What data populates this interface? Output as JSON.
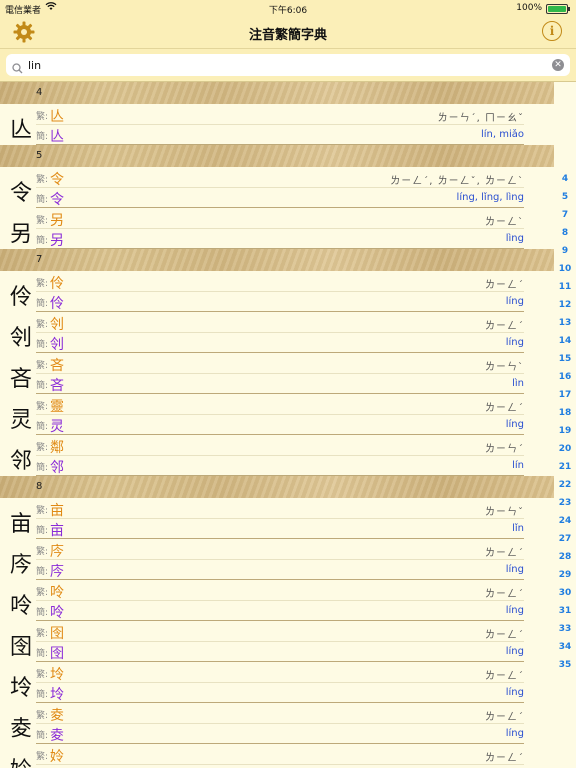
{
  "status": {
    "carrier": "電信業者",
    "time": "下午6:06",
    "battery": "100%"
  },
  "nav": {
    "title": "注音繁簡字典"
  },
  "search": {
    "value": "lin",
    "placeholder": ""
  },
  "sections": [
    {
      "label": "4",
      "entries": [
        {
          "char": "亾",
          "trad": "亾",
          "simp": "亾",
          "zhuyin": "ㄌㄧㄣˊ, ㄇㄧㄠˇ",
          "pinyin": "lín, miǎo"
        }
      ]
    },
    {
      "label": "5",
      "entries": [
        {
          "char": "令",
          "trad": "令",
          "simp": "令",
          "zhuyin": "ㄌㄧㄥˊ, ㄌㄧㄥˇ, ㄌㄧㄥˋ",
          "pinyin": "líng, lǐng, lìng"
        },
        {
          "char": "另",
          "trad": "另",
          "simp": "另",
          "zhuyin": "ㄌㄧㄥˋ",
          "pinyin": "lìng"
        }
      ]
    },
    {
      "label": "7",
      "entries": [
        {
          "char": "伶",
          "trad": "伶",
          "simp": "伶",
          "zhuyin": "ㄌㄧㄥˊ",
          "pinyin": "líng"
        },
        {
          "char": "刢",
          "trad": "刢",
          "simp": "刢",
          "zhuyin": "ㄌㄧㄥˊ",
          "pinyin": "líng"
        },
        {
          "char": "吝",
          "trad": "吝",
          "simp": "吝",
          "zhuyin": "ㄌㄧㄣˋ",
          "pinyin": "lìn"
        },
        {
          "char": "灵",
          "trad": "靈",
          "simp": "灵",
          "zhuyin": "ㄌㄧㄥˊ",
          "pinyin": "líng"
        },
        {
          "char": "邻",
          "trad": "鄰",
          "simp": "邻",
          "zhuyin": "ㄌㄧㄣˊ",
          "pinyin": "lín"
        }
      ]
    },
    {
      "label": "8",
      "entries": [
        {
          "char": "亩",
          "trad": "亩",
          "simp": "亩",
          "zhuyin": "ㄌㄧㄣˇ",
          "pinyin": "lǐn"
        },
        {
          "char": "庈",
          "trad": "庈",
          "simp": "庈",
          "zhuyin": "ㄌㄧㄥˊ",
          "pinyin": "líng"
        },
        {
          "char": "呤",
          "trad": "呤",
          "simp": "呤",
          "zhuyin": "ㄌㄧㄥˊ",
          "pinyin": "líng"
        },
        {
          "char": "囹",
          "trad": "囹",
          "simp": "囹",
          "zhuyin": "ㄌㄧㄥˊ",
          "pinyin": "líng"
        },
        {
          "char": "坽",
          "trad": "坽",
          "simp": "坽",
          "zhuyin": "ㄌㄧㄥˊ",
          "pinyin": "líng"
        },
        {
          "char": "夌",
          "trad": "夌",
          "simp": "夌",
          "zhuyin": "ㄌㄧㄥˊ",
          "pinyin": "líng"
        },
        {
          "char": "姈",
          "trad": "姈",
          "simp": "",
          "zhuyin": "ㄌㄧㄥˊ",
          "pinyin": ""
        }
      ]
    }
  ],
  "labels": {
    "trad": "繁:",
    "simp": "簡:"
  },
  "index": [
    "4",
    "5",
    "7",
    "8",
    "9",
    "10",
    "11",
    "12",
    "13",
    "14",
    "15",
    "16",
    "17",
    "18",
    "19",
    "20",
    "21",
    "22",
    "23",
    "24",
    "27",
    "28",
    "29",
    "30",
    "31",
    "33",
    "34",
    "35"
  ],
  "colors": {
    "trad": "#e08a14",
    "simp": "#8a2bd8",
    "pinyin": "#2a4fd0",
    "index": "#1f7de0",
    "accent": "#c28a18"
  }
}
